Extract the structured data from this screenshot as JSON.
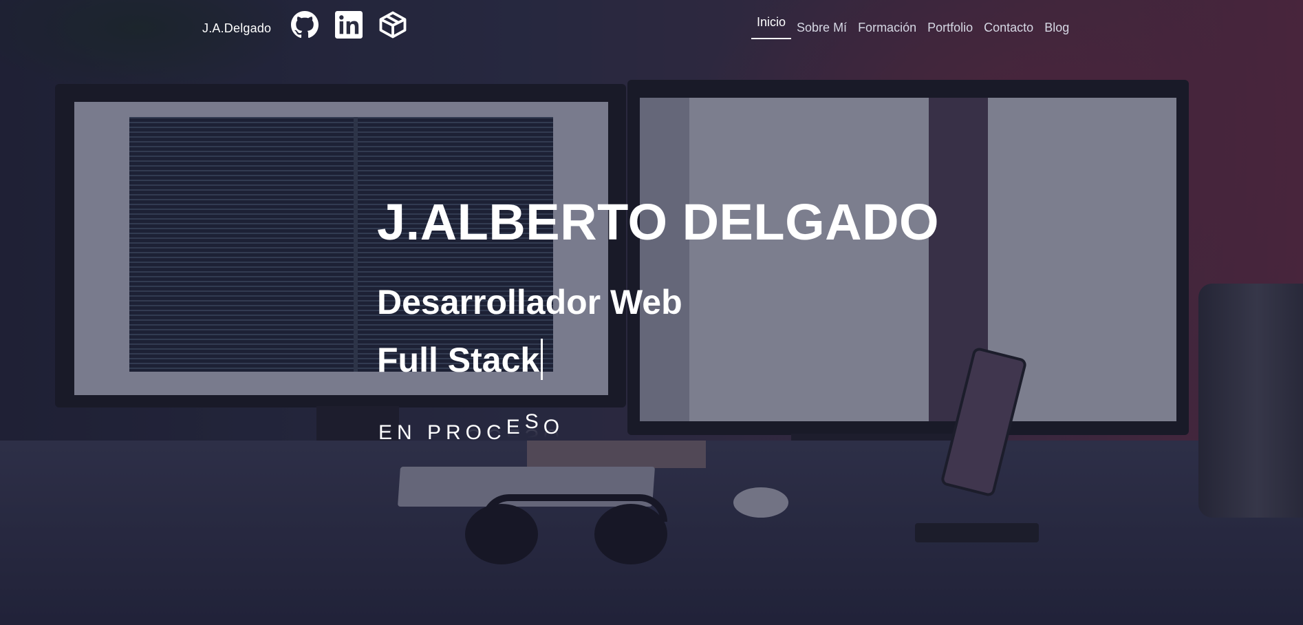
{
  "header": {
    "brand": "J.A.Delgado",
    "social": [
      {
        "name": "github",
        "icon": "github-icon"
      },
      {
        "name": "linkedin",
        "icon": "linkedin-icon"
      },
      {
        "name": "codepen",
        "icon": "codepen-icon"
      }
    ],
    "menu": [
      {
        "label": "Inicio",
        "active": true
      },
      {
        "label": "Sobre Mí",
        "active": false
      },
      {
        "label": "Formación",
        "active": false
      },
      {
        "label": "Portfolio",
        "active": false
      },
      {
        "label": "Contacto",
        "active": false
      },
      {
        "label": "Blog",
        "active": false
      }
    ]
  },
  "hero": {
    "name": "J.ALBERTO DELGADO",
    "role_line1": "Desarrollador Web",
    "role_line2": "Full Stack",
    "status_parts": [
      "EN PROC",
      "E",
      "S",
      "O"
    ]
  },
  "colors": {
    "text": "#ffffff",
    "menu_inactive": "#d6d8e4",
    "overlay": "#1e2037"
  }
}
